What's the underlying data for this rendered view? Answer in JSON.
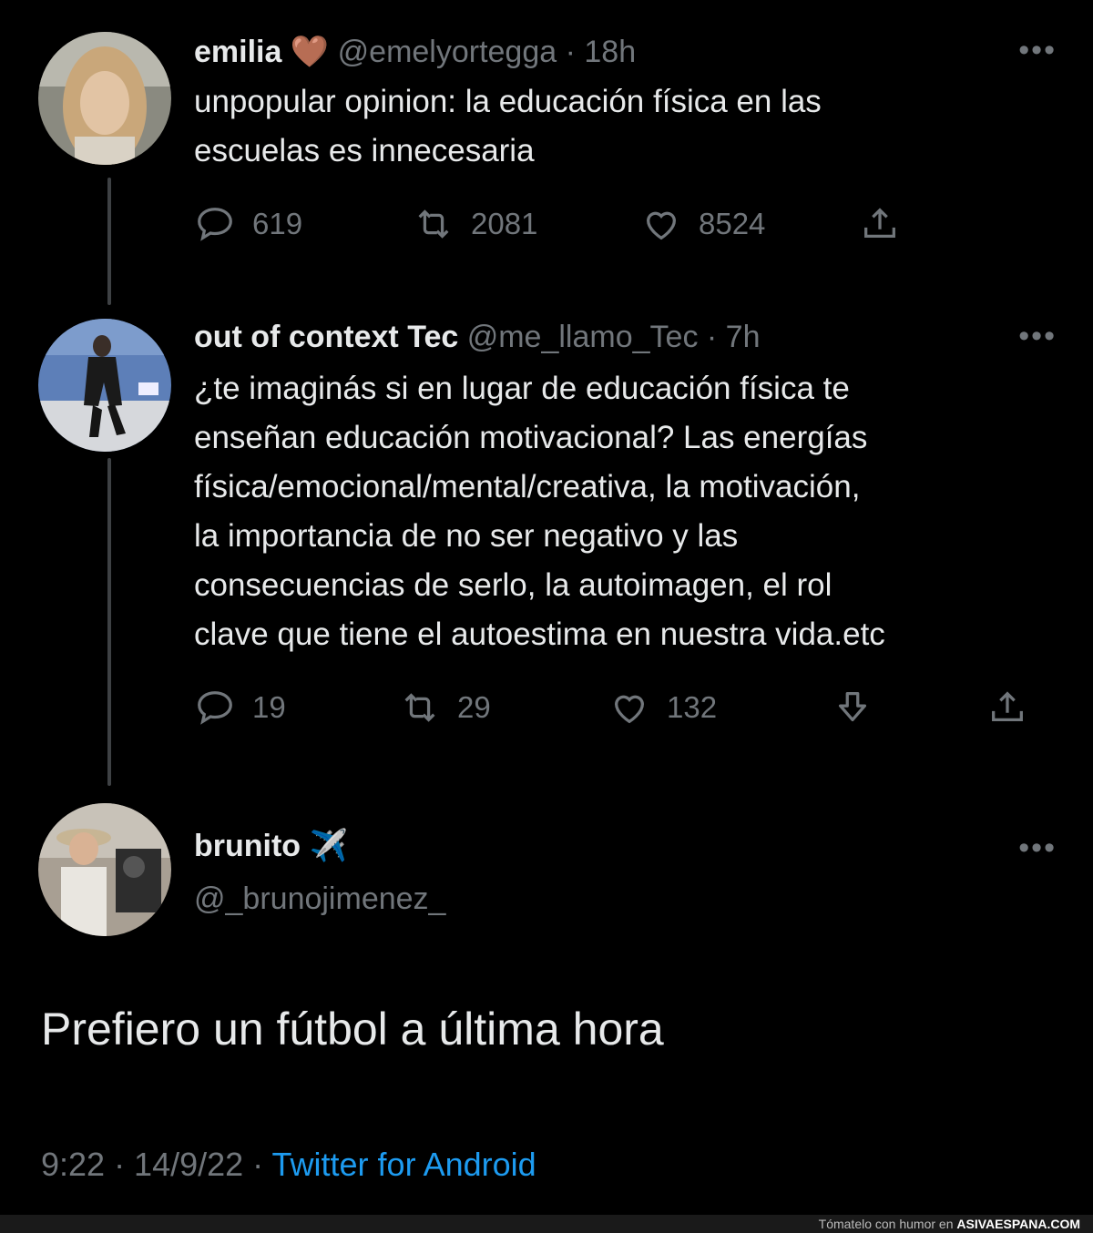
{
  "tweet1": {
    "name": "emilia",
    "emoji": "🤎",
    "handle": "@emelyortegga",
    "time": "· 18h",
    "text_line1": "unpopular opinion: la educación física en las",
    "text_line2": "escuelas es innecesaria",
    "replies": "619",
    "retweets": "2081",
    "likes": "8524"
  },
  "tweet2": {
    "name": "out of context Tec",
    "handle": "@me_llamo_Tec",
    "time": "· 7h",
    "lines": [
      "¿te imaginás si en lugar de educación física te",
      "enseñan educación motivacional? Las energías",
      "física/emocional/mental/creativa, la motivación,",
      "la importancia de no ser negativo y las",
      "consecuencias de serlo, la autoimagen, el rol",
      "clave que tiene el autoestima en nuestra vida.etc"
    ],
    "replies": "19",
    "retweets": "29",
    "likes": "132"
  },
  "tweet3": {
    "name": "brunito",
    "emoji": "✈️",
    "handle": "@_brunojimenez_",
    "text": "Prefiero un fútbol a última hora",
    "time": "9:22 · 14/9/22 ·",
    "source": "Twitter for Android"
  },
  "footer": {
    "prefix": "Tómatelo con humor en",
    "site": "ASIVAESPANA.COM"
  },
  "icons": {
    "more": "more-icon",
    "reply": "reply-icon",
    "retweet": "retweet-icon",
    "like": "heart-icon",
    "share": "share-icon",
    "downvote": "downvote-icon"
  },
  "colors": {
    "background": "#000000",
    "text": "#e7e9ea",
    "muted": "#71767b",
    "link": "#1d9bf0"
  }
}
